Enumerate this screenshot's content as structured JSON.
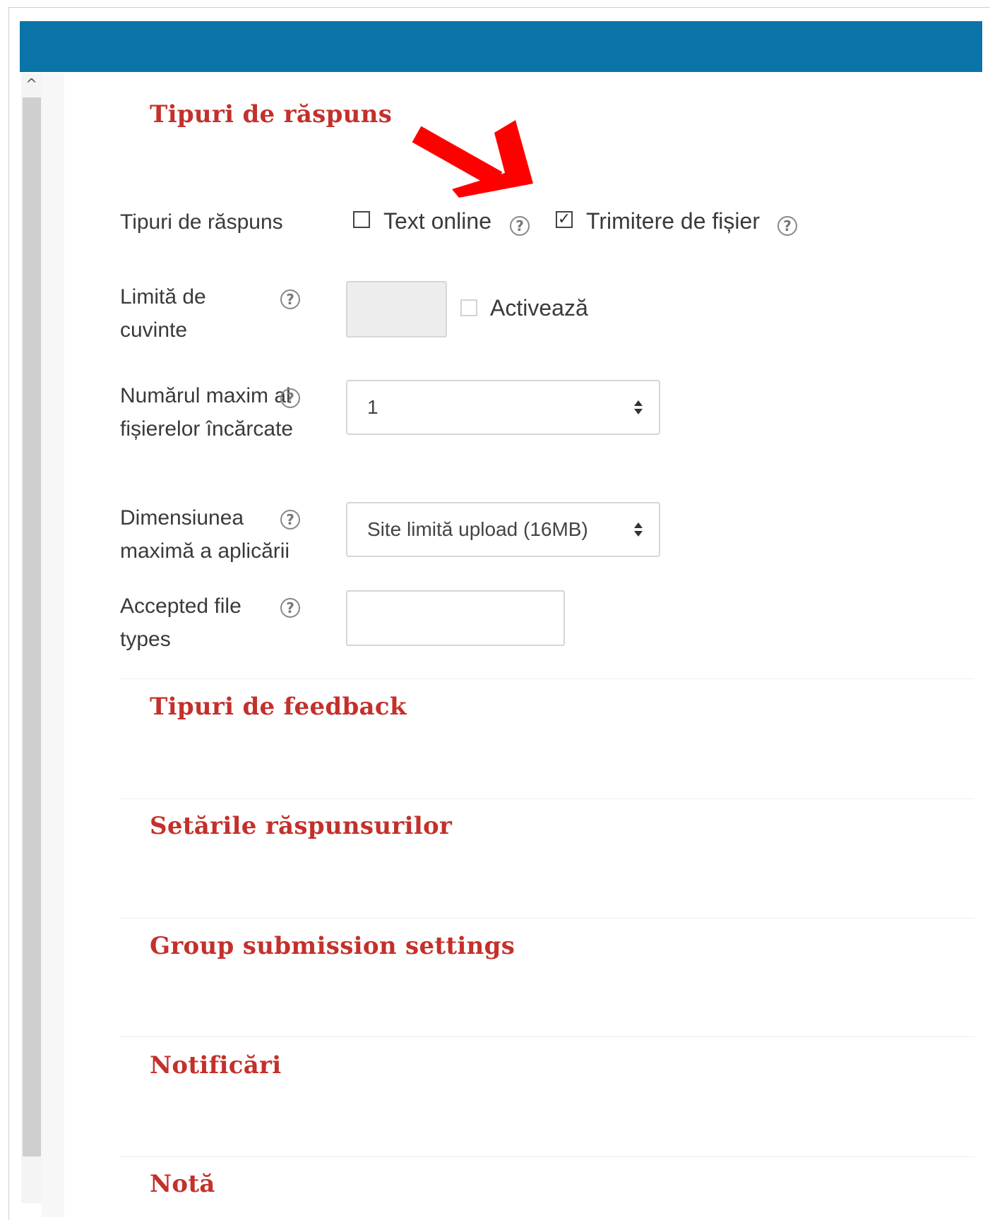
{
  "annotation_color": "#ff0000",
  "accent_color": "#0a73a8",
  "heading_color": "#c4302b",
  "scrollbar": {
    "up_icon": "^"
  },
  "sections": {
    "response_types": "Tipuri de răspuns",
    "feedback_types": "Tipuri de feedback",
    "submission_settings": "Setările răspunsurilor",
    "group_submission": "Group submission settings",
    "notifications": "Notificări",
    "grade": "Notă"
  },
  "form": {
    "response_types": {
      "label": "Tipuri de răspuns",
      "online_text": {
        "label": "Text online",
        "checked": false
      },
      "file_submission": {
        "label": "Trimitere de fișier",
        "checked": true
      }
    },
    "word_limit": {
      "label": "Limită de cuvinte",
      "value": "",
      "enable_label": "Activează",
      "enabled": false
    },
    "max_files": {
      "label": "Numărul maxim al fișierelor încărcate",
      "value": "1"
    },
    "max_size": {
      "label": "Dimensiunea maximă a aplicării",
      "value": "Site limită upload (16MB)"
    },
    "accepted_types": {
      "label": "Accepted file types",
      "value": ""
    }
  },
  "help_icon": "?",
  "check_mark": "✓"
}
